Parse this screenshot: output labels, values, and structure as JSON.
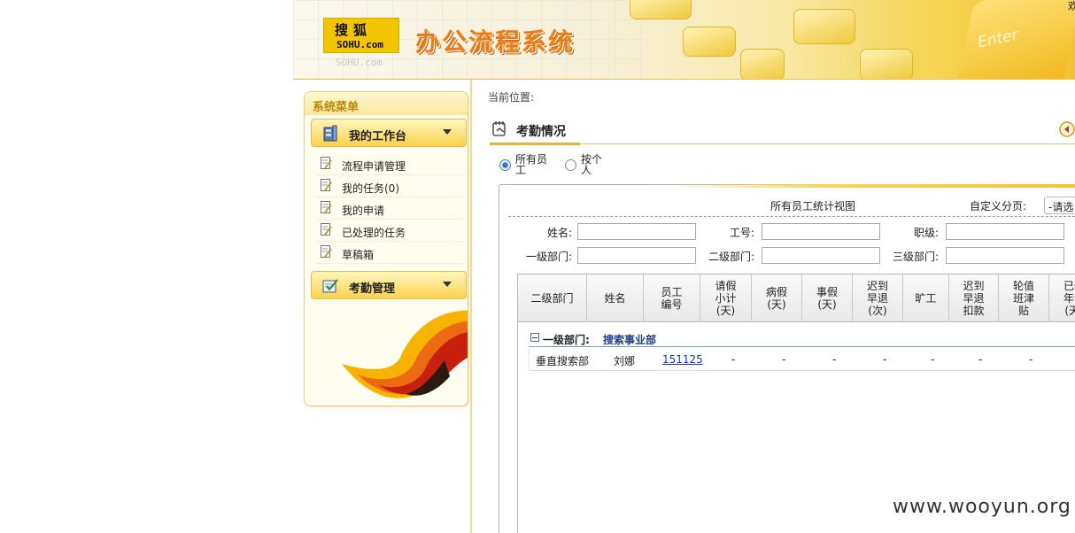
{
  "header": {
    "logo_cn": "搜狐",
    "logo_en": "SOHU.com",
    "logo_reflection": "SOHU.com",
    "system_title": "办公流程系统",
    "enter_key_text": "Enter",
    "welcome_text": "欢"
  },
  "sidebar": {
    "title": "系统菜单",
    "groups": [
      {
        "label": "我的工作台",
        "icon": "workbench-icon"
      },
      {
        "label": "考勤管理",
        "icon": "attendance-icon"
      }
    ],
    "items": [
      {
        "label": "流程申请管理",
        "icon": "document-edit-icon"
      },
      {
        "label": "我的任务(0)",
        "icon": "document-edit-icon"
      },
      {
        "label": "我的申请",
        "icon": "document-edit-icon"
      },
      {
        "label": "已处理的任务",
        "icon": "document-edit-icon"
      },
      {
        "label": "草稿箱",
        "icon": "document-edit-icon"
      }
    ]
  },
  "content": {
    "breadcrumb": "当前位置:",
    "section_title": "考勤情况",
    "back_icon": "back-arrow-icon",
    "radios": [
      {
        "label": "所有员工",
        "checked": true
      },
      {
        "label": "按个人",
        "checked": false
      }
    ],
    "panel": {
      "view_title": "所有员工统计视图",
      "custom_page_label": "自定义分页:",
      "page_select_value": "-请选",
      "filters": {
        "name": "姓名:",
        "emp_no": "工号:",
        "level": "职级:",
        "dept1": "一级部门:",
        "dept2": "二级部门:",
        "dept3": "三级部门:"
      }
    },
    "table": {
      "columns": [
        "二级部门",
        "姓名",
        "员工编号",
        "请假小计(天)",
        "病假(天)",
        "事假(天)",
        "迟到早退(次)",
        "旷工",
        "迟到早退扣款",
        "轮值班津贴",
        "已休年假(天)"
      ],
      "group": {
        "label": "一级部门:",
        "name": "搜索事业部"
      },
      "rows": [
        {
          "dept2": "垂直搜索部",
          "name": "刘娜",
          "emp_no": "151125",
          "leave_total": "-",
          "sick": "-",
          "personal": "-",
          "late": "-",
          "absent": "-",
          "late_deduct": "-",
          "shift_allowance": "-"
        }
      ]
    }
  },
  "watermark": "www.wooyun.org",
  "colors": {
    "accent_orange": "#ec7c14",
    "menu_gold": "#fbd24f",
    "link_blue": "#1b36c6",
    "group_blue": "#1e3f83"
  }
}
